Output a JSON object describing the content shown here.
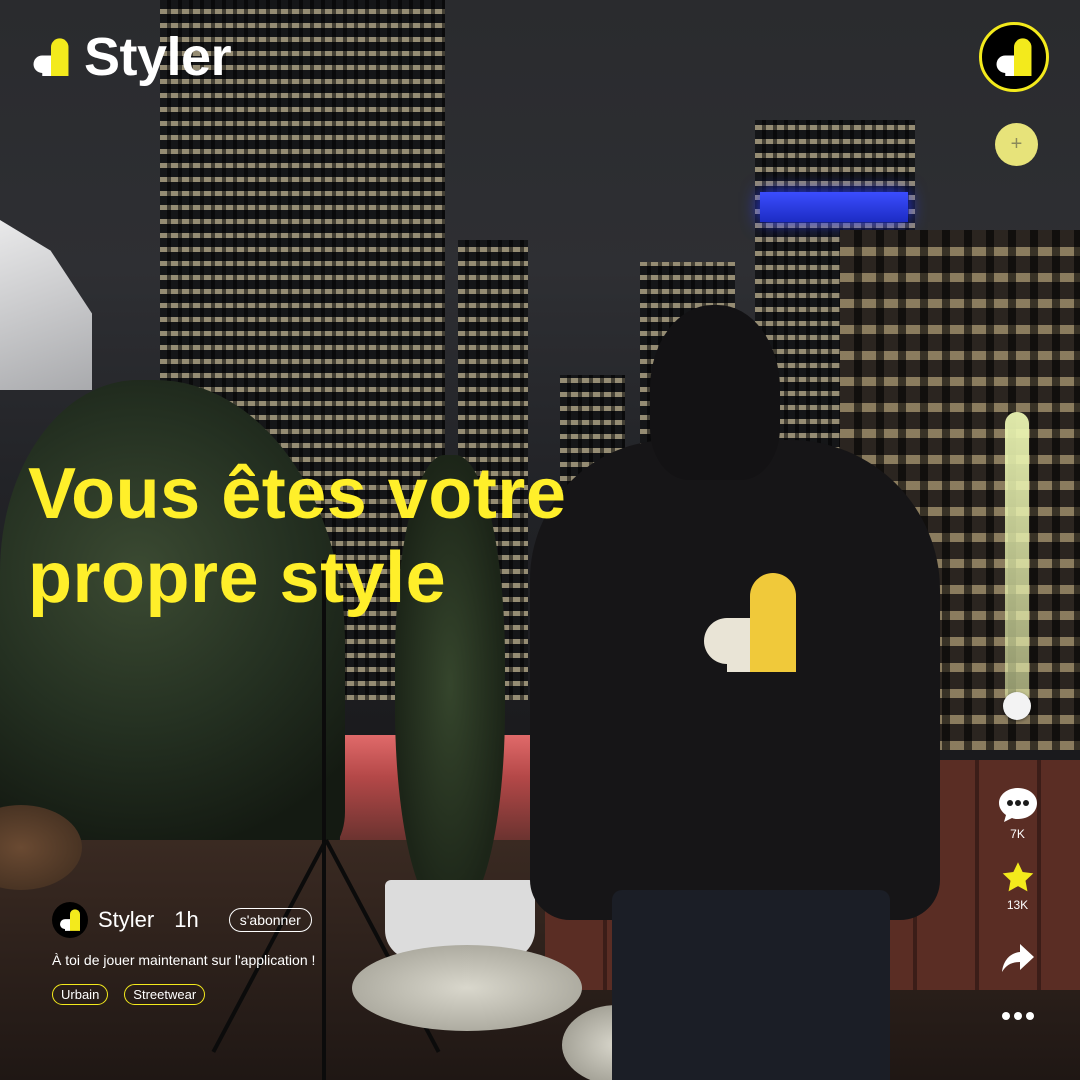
{
  "brand": {
    "name": "Styler"
  },
  "headline": {
    "text": "Vous êtes votre propre style"
  },
  "post": {
    "author": "Styler",
    "time": "1h",
    "subscribe_label": "s'abonner",
    "caption": "À toi de jouer maintenant sur l'application !",
    "tags": [
      "Urbain",
      "Streetwear"
    ]
  },
  "actions": {
    "comments_count": "7K",
    "stars_count": "13K"
  },
  "progress": {
    "value": 1.0
  },
  "colors": {
    "accent": "#f3ea1c",
    "headline": "#ffef2a"
  },
  "icons": [
    "heart-logo-icon",
    "plus-icon",
    "comment-icon",
    "star-icon",
    "share-icon",
    "more-icon"
  ]
}
